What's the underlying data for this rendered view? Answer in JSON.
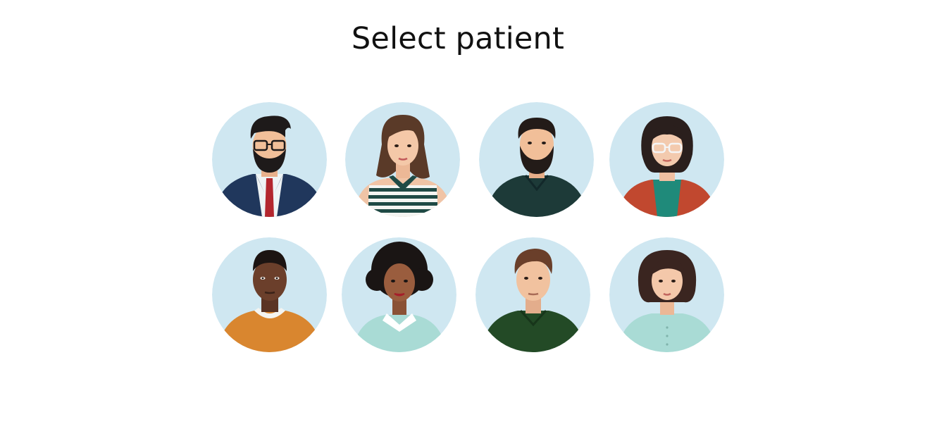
{
  "header": {
    "title": "Select patient"
  },
  "colors": {
    "avatar_background": "#cfe7f1",
    "page_background": "#ffffff",
    "title_text": "#111111"
  },
  "patients": [
    {
      "icon": "man-beard-glasses-suit-avatar-icon"
    },
    {
      "icon": "woman-long-hair-striped-top-avatar-icon"
    },
    {
      "icon": "man-beard-dark-shirt-avatar-icon"
    },
    {
      "icon": "woman-bob-glasses-red-jacket-avatar-icon"
    },
    {
      "icon": "man-orange-sweater-avatar-icon"
    },
    {
      "icon": "woman-curly-hair-avatar-icon"
    },
    {
      "icon": "man-green-polo-avatar-icon"
    },
    {
      "icon": "woman-shoulder-hair-mint-top-avatar-icon"
    }
  ]
}
